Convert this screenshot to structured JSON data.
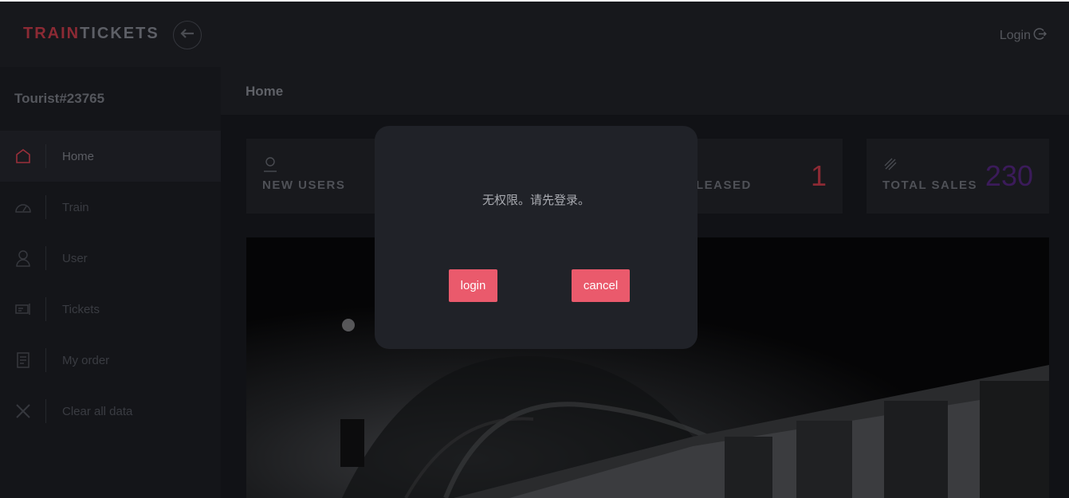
{
  "header": {
    "brand_part1": "TRAIN",
    "brand_part2": "TICKETS",
    "login_label": "Login",
    "brand_color": "#8c2a34"
  },
  "sidebar": {
    "user_name": "Tourist#23765",
    "items": [
      {
        "label": "Home",
        "icon": "home-icon",
        "active": true
      },
      {
        "label": "Train",
        "icon": "speedometer-icon",
        "active": false
      },
      {
        "label": "User",
        "icon": "user-icon",
        "active": false
      },
      {
        "label": "Tickets",
        "icon": "ticket-icon",
        "active": false
      },
      {
        "label": "My order",
        "icon": "order-icon",
        "active": false
      },
      {
        "label": "Clear all data",
        "icon": "close-icon",
        "active": false
      }
    ]
  },
  "main": {
    "breadcrumb": "Home",
    "stats": [
      {
        "label": "NEW USERS",
        "value": "",
        "icon": "user-icon"
      },
      {
        "label": "LEASED",
        "value": "1",
        "icon": "",
        "color": "#8c2a34"
      },
      {
        "label": "TOTAL SALES",
        "value": "230",
        "icon": "rocket-icon",
        "color": "#3b1b5a"
      }
    ]
  },
  "modal": {
    "message": "无权限。请先登录。",
    "login_button": "login",
    "cancel_button": "cancel",
    "button_color": "#ea5a6c"
  }
}
